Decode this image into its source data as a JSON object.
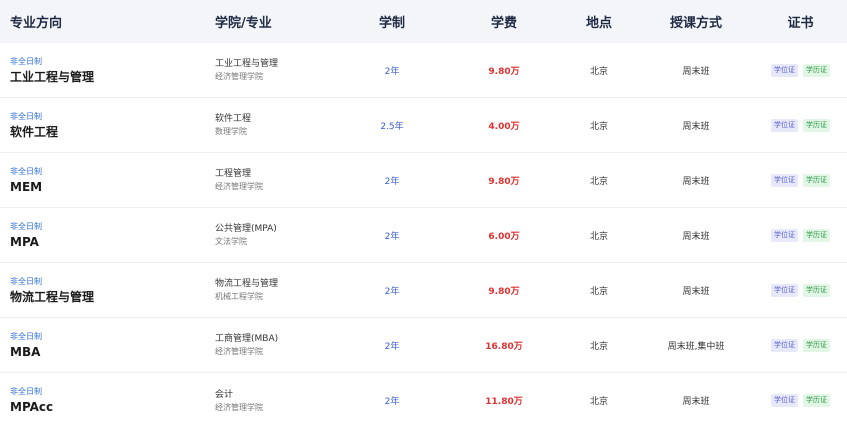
{
  "table": {
    "headers": [
      "专业方向",
      "学院/专业",
      "学制",
      "学费",
      "地点",
      "授课方式",
      "证书"
    ],
    "rows": [
      {
        "badge": "非全日制",
        "major": "工业工程与管理",
        "school_major": "工业工程与管理",
        "school": "经济管理学院",
        "duration": "2年",
        "fee": "9.80万",
        "location": "北京",
        "mode": "周末班",
        "cert_degree": "学位证",
        "cert_diploma": "学历证"
      },
      {
        "badge": "非全日制",
        "major": "软件工程",
        "school_major": "软件工程",
        "school": "数理学院",
        "duration": "2.5年",
        "fee": "4.00万",
        "location": "北京",
        "mode": "周末班",
        "cert_degree": "学位证",
        "cert_diploma": "学历证"
      },
      {
        "badge": "非全日制",
        "major": "MEM",
        "school_major": "工程管理",
        "school": "经济管理学院",
        "duration": "2年",
        "fee": "9.80万",
        "location": "北京",
        "mode": "周末班",
        "cert_degree": "学位证",
        "cert_diploma": "学历证"
      },
      {
        "badge": "非全日制",
        "major": "MPA",
        "school_major": "公共管理(MPA)",
        "school": "文法学院",
        "duration": "2年",
        "fee": "6.00万",
        "location": "北京",
        "mode": "周末班",
        "cert_degree": "学位证",
        "cert_diploma": "学历证"
      },
      {
        "badge": "非全日制",
        "major": "物流工程与管理",
        "school_major": "物流工程与管理",
        "school": "机械工程学院",
        "duration": "2年",
        "fee": "9.80万",
        "location": "北京",
        "mode": "周末班",
        "cert_degree": "学位证",
        "cert_diploma": "学历证"
      },
      {
        "badge": "非全日制",
        "major": "MBA",
        "school_major": "工商管理(MBA)",
        "school": "经济管理学院",
        "duration": "2年",
        "fee": "16.80万",
        "location": "北京",
        "mode": "周末班,集中班",
        "cert_degree": "学位证",
        "cert_diploma": "学历证"
      },
      {
        "badge": "非全日制",
        "major": "MPAcc",
        "school_major": "会计",
        "school": "经济管理学院",
        "duration": "2年",
        "fee": "11.80万",
        "location": "北京",
        "mode": "周末班",
        "cert_degree": "学位证",
        "cert_diploma": "学历证"
      }
    ]
  },
  "colors": {
    "header_bg": "#f3f5f8",
    "badge": "#2f6fd6",
    "duration": "#3b5fd0",
    "fee": "#e03030",
    "cert_degree_bg": "#e7e9fb",
    "cert_degree_text": "#5a5fd6",
    "cert_diploma_bg": "#e2f6e6",
    "cert_diploma_text": "#2f9a48"
  }
}
